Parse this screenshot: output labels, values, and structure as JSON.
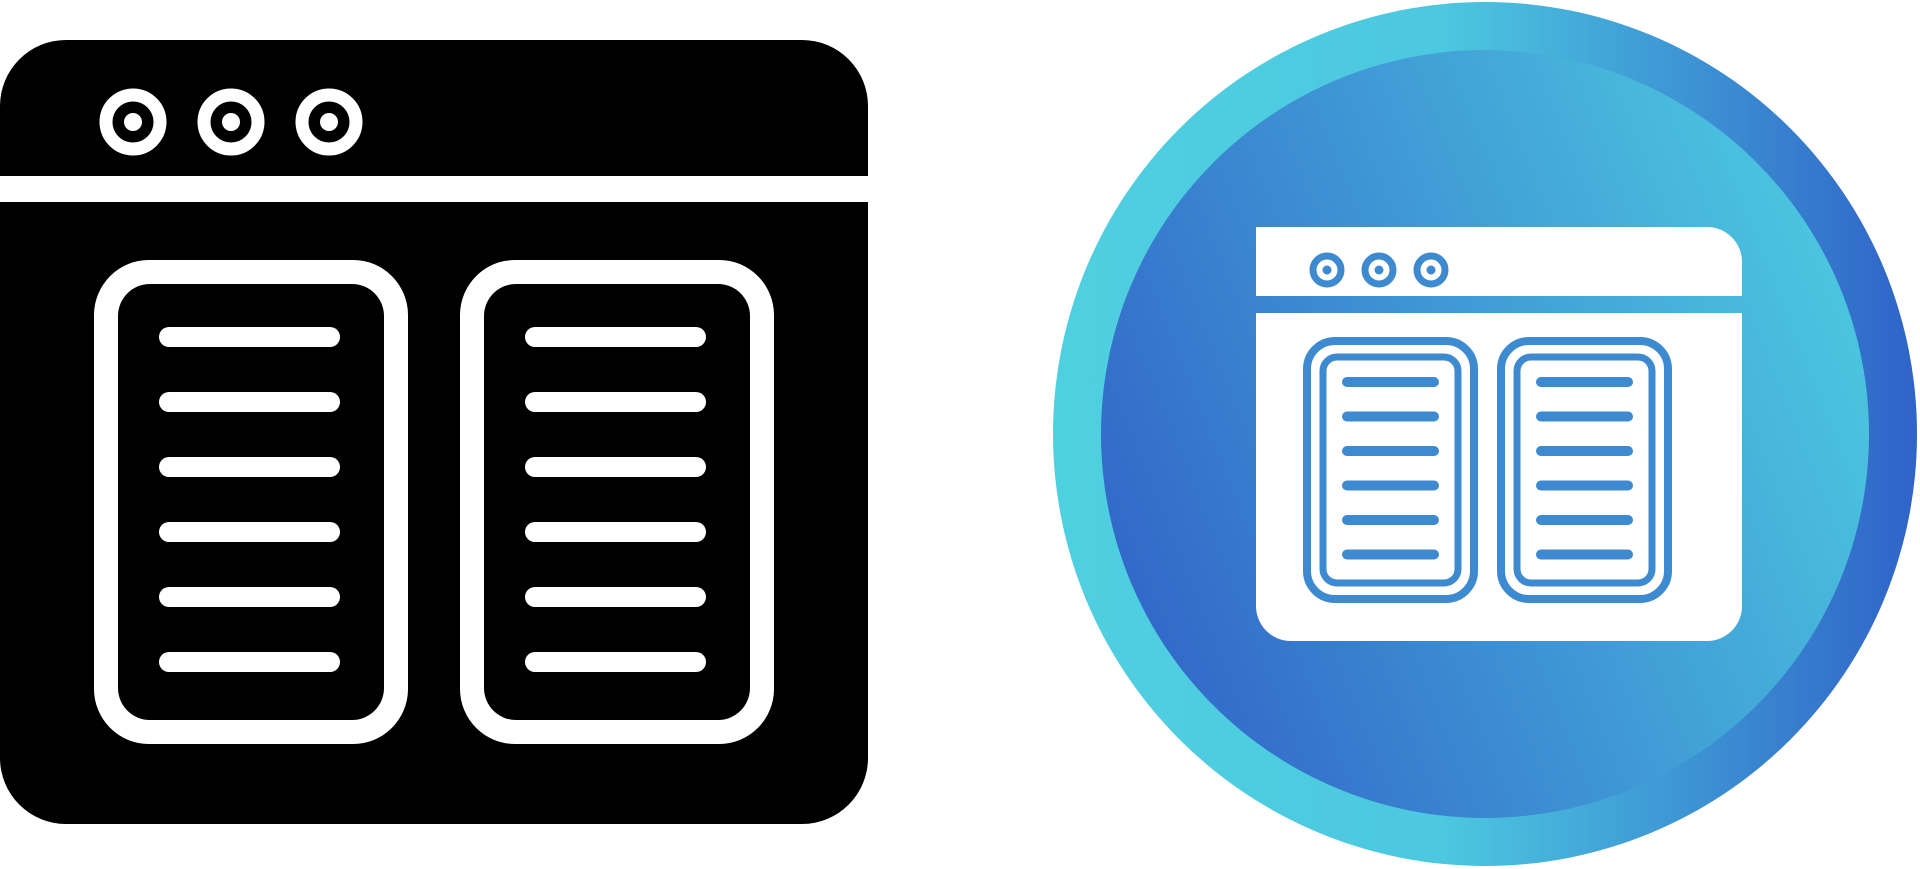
{
  "icons": [
    {
      "name": "browser-two-columns-glyph-icon",
      "style": "glyph",
      "colors": {
        "fill": "#000000",
        "detail": "#ffffff"
      },
      "window_dots": 3,
      "columns": 2,
      "lines_per_column": 6
    },
    {
      "name": "browser-two-columns-gradient-circle-icon",
      "style": "gradient-circle",
      "colors": {
        "gradient_light": "#4fd0e0",
        "gradient_dark": "#2f63c8",
        "inner_dark": "#3266c9",
        "inner_light": "#4cc8e0",
        "window": "#ffffff",
        "detail": "#3d8ad0"
      },
      "window_dots": 3,
      "columns": 2,
      "lines_per_column": 6
    }
  ]
}
